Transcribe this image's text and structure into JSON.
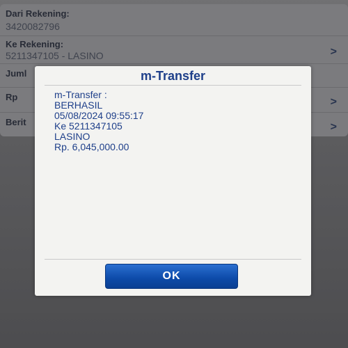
{
  "form": {
    "from_label": "Dari Rekening:",
    "from_value": "3420082796",
    "to_label": "Ke Rekening:",
    "to_value": "5211347105 - LASINO",
    "amount_label": "Juml",
    "currency_label": "Rp",
    "message_label": "Berit",
    "chevron": ">"
  },
  "dialog": {
    "title": "m-Transfer",
    "lines": [
      "m-Transfer :",
      "BERHASIL",
      "05/08/2024 09:55:17",
      "Ke 5211347105",
      "LASINO",
      "Rp. 6,045,000.00"
    ],
    "ok_label": "OK"
  },
  "colors": {
    "dialog_text": "#1e3f8a",
    "ok_button": "#0d4aa8"
  }
}
